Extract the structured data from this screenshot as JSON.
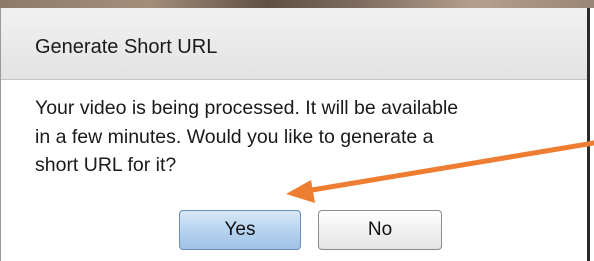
{
  "dialog": {
    "title": "Generate Short URL",
    "message_lines": [
      "Your video is being processed. It will be available",
      "in a few minutes. Would you like to generate a",
      "short URL for it?"
    ],
    "buttons": {
      "yes": "Yes",
      "no": "No"
    }
  },
  "annotation": {
    "arrow_color": "#ed7d31",
    "arrow_target": "yes-button"
  },
  "colors": {
    "yes_button_fill": "#b7d3ef",
    "title_bar_fill": "#e9e9e9"
  }
}
